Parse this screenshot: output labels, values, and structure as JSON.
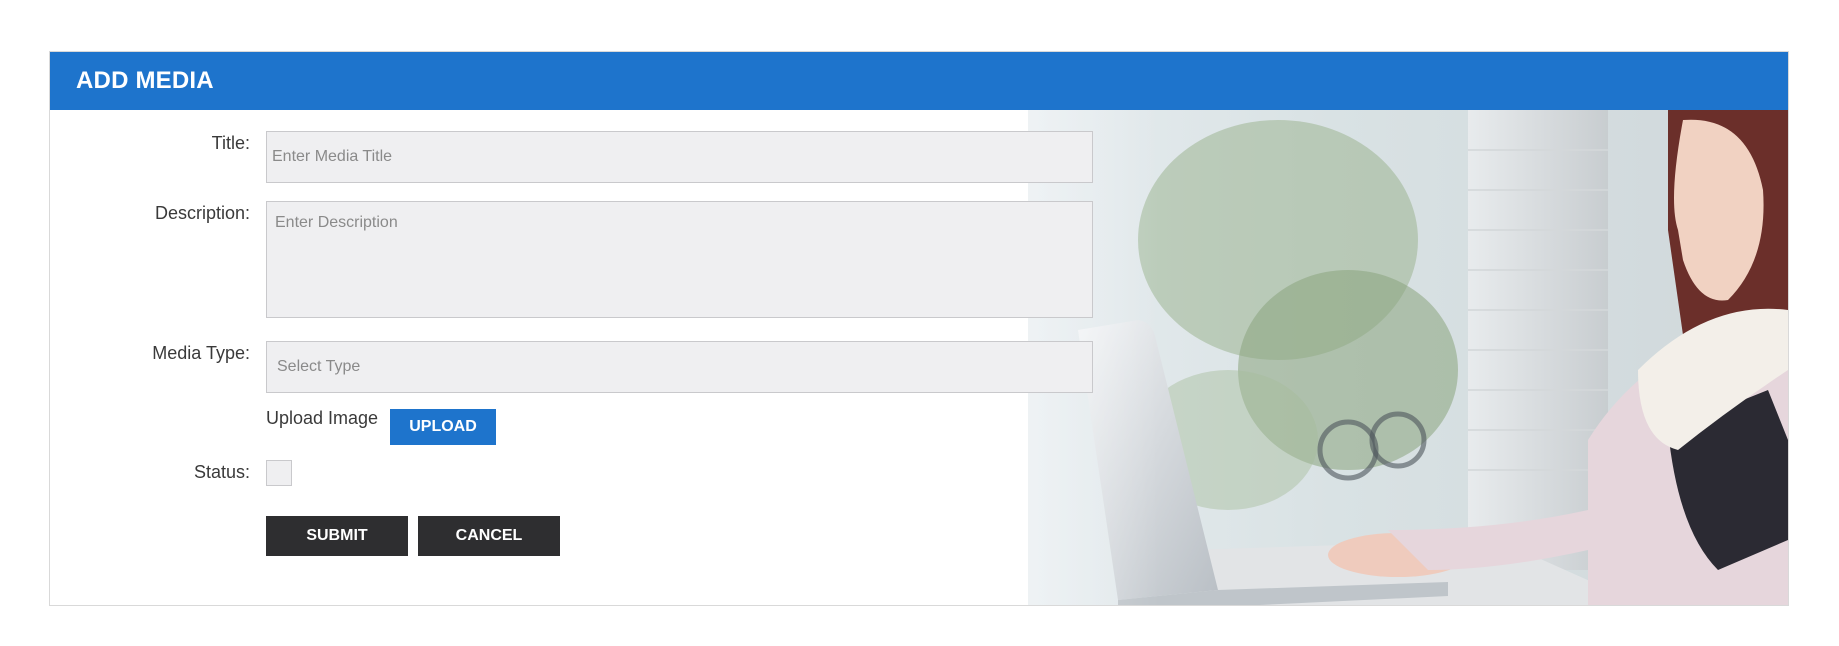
{
  "header": {
    "title": "ADD MEDIA"
  },
  "form": {
    "title_label": "Title:",
    "title_placeholder": "Enter Media Title",
    "description_label": "Description:",
    "description_placeholder": "Enter Description",
    "media_type_label": "Media Type:",
    "media_type_value": "Select Type",
    "upload_label": "Upload Image",
    "upload_button": "UPLOAD",
    "status_label": "Status:",
    "status_checked": false,
    "submit_button": "SUBMIT",
    "cancel_button": "CANCEL"
  },
  "colors": {
    "header_bg": "#1e74cc",
    "button_dark": "#2e2e30",
    "field_bg": "#efeff1"
  },
  "icons": {
    "hero": "woman-with-laptop-photo"
  }
}
